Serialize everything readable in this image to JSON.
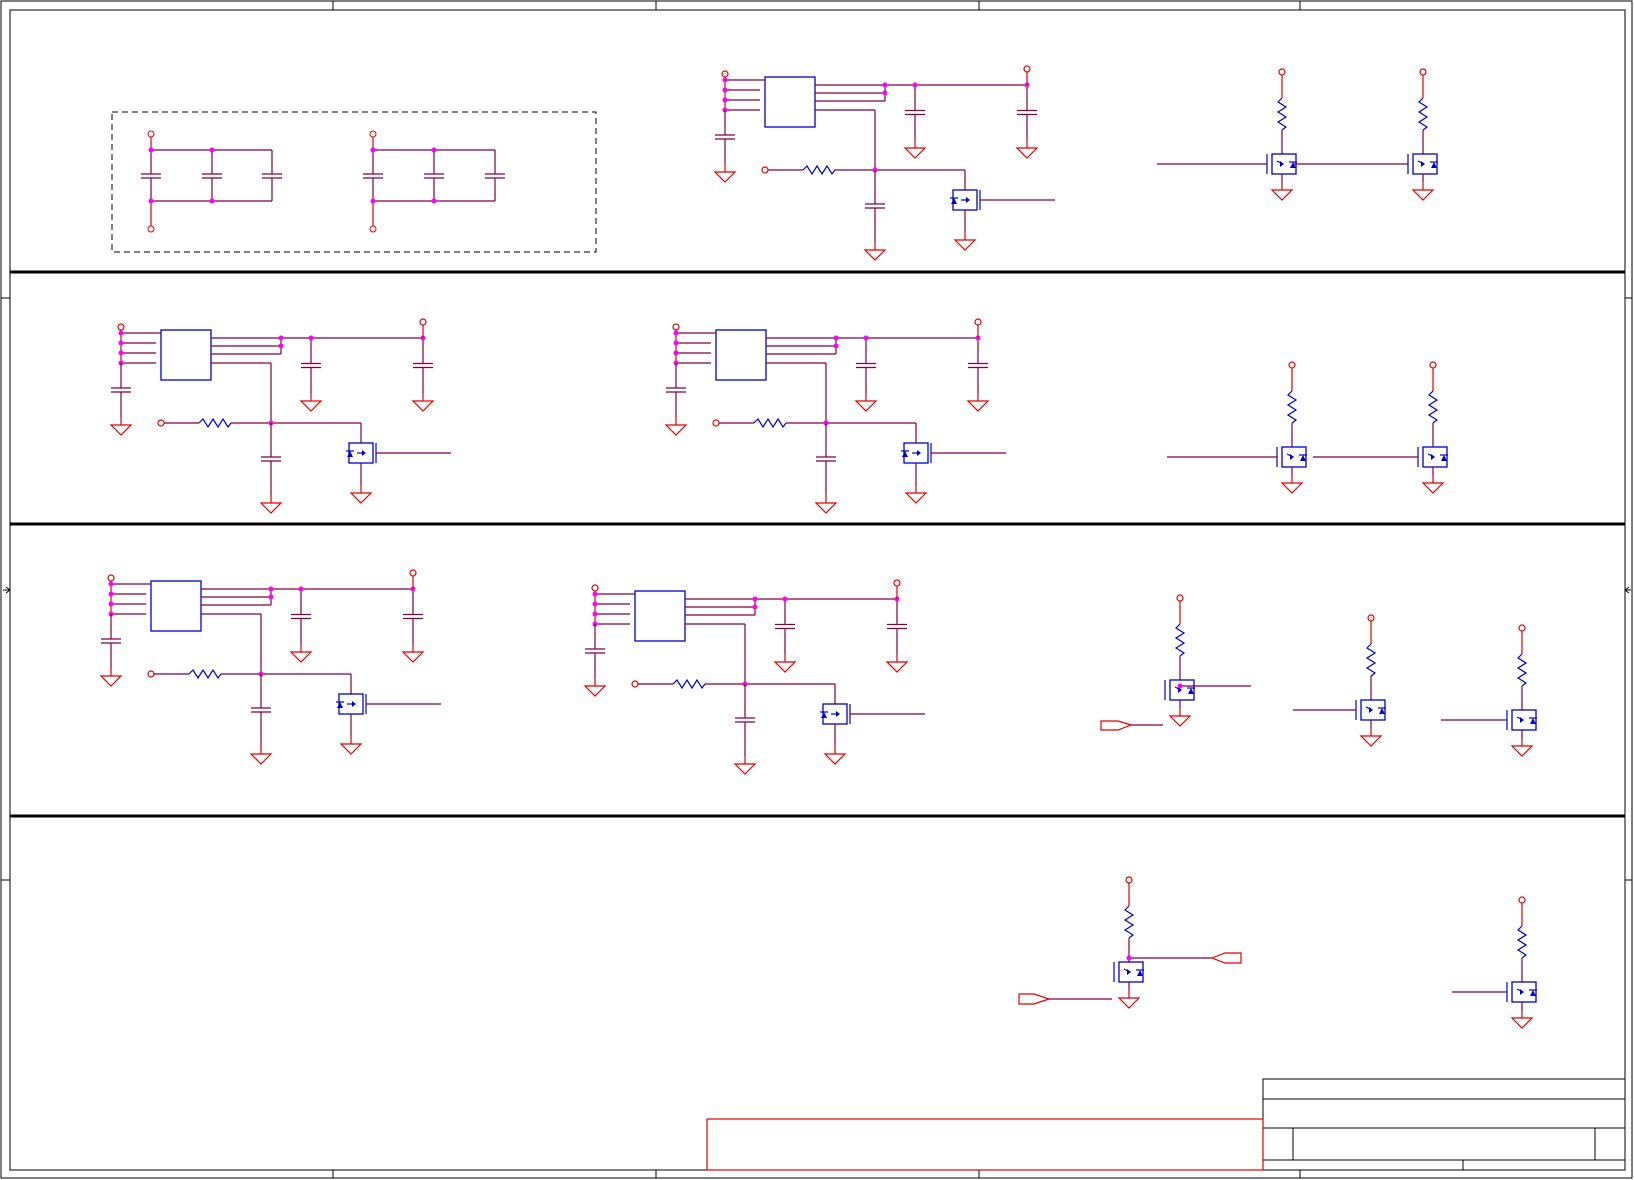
{
  "sheet": {
    "title": "",
    "colors": {
      "wire": "#800040",
      "power_symbol": "#e00000",
      "component": "#0000cc",
      "junction": "#ff00ff",
      "frame": "#000000",
      "background": "#ffffff"
    }
  },
  "title_block": {
    "visible_text": []
  },
  "diagram": {
    "type": "electrical-schematic",
    "sections": [
      {
        "name": "decoupling-and-regulator",
        "parts": [
          "capacitor-bank-group-dashed",
          "regulator-ic",
          "switch-mosfet",
          "pullup-mosfet-x2"
        ]
      },
      {
        "name": "regulators-row-2",
        "parts": [
          "regulator-ic-x2",
          "switch-mosfet-x2",
          "pullup-mosfet-x2"
        ]
      },
      {
        "name": "regulators-row-3",
        "parts": [
          "regulator-ic-x2",
          "switch-mosfet-x2",
          "pullup-mosfet-x3",
          "net-label"
        ]
      },
      {
        "name": "level-shifters",
        "parts": [
          "pullup-mosfet-x2",
          "net-label-x2"
        ]
      }
    ]
  }
}
